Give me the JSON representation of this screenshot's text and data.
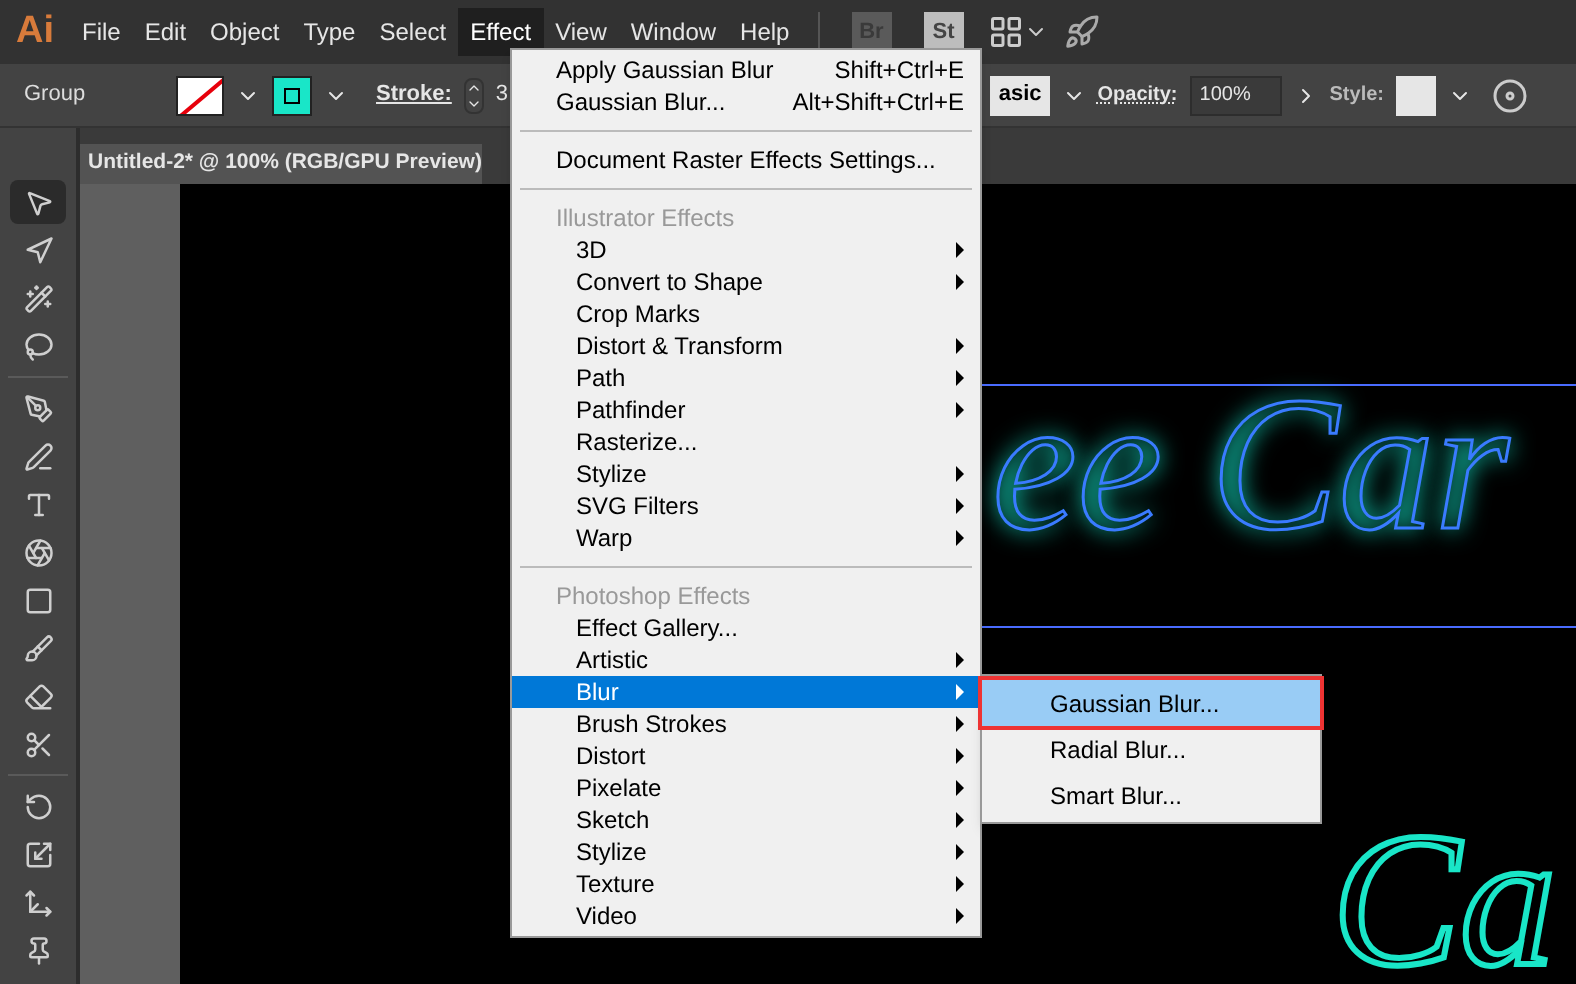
{
  "app_logo": "Ai",
  "menu_bar": [
    {
      "label": "File",
      "selected": false
    },
    {
      "label": "Edit",
      "selected": false
    },
    {
      "label": "Object",
      "selected": false
    },
    {
      "label": "Type",
      "selected": false
    },
    {
      "label": "Select",
      "selected": false
    },
    {
      "label": "Effect",
      "selected": true
    },
    {
      "label": "View",
      "selected": false
    },
    {
      "label": "Window",
      "selected": false
    },
    {
      "label": "Help",
      "selected": false
    }
  ],
  "menu_bar_badges": [
    "Br",
    "St"
  ],
  "control_bar": {
    "selection": "Group",
    "stroke_label": "Stroke:",
    "stroke_value": "3",
    "blend_value": "asic",
    "opacity_label": "Opacity:",
    "opacity_value": "100%",
    "style_label": "Style:"
  },
  "document_tab": "Untitled-2* @ 100% (RGB/GPU Preview)",
  "tools": [
    {
      "kind": "selection",
      "selected": true
    },
    {
      "kind": "direct",
      "selected": false
    },
    {
      "kind": "wand",
      "selected": false
    },
    {
      "kind": "lasso",
      "selected": false
    },
    {
      "kind": "pen",
      "selected": false
    },
    {
      "kind": "curvature",
      "selected": false
    },
    {
      "kind": "type",
      "selected": false
    },
    {
      "kind": "grid",
      "selected": false
    },
    {
      "kind": "rect",
      "selected": false
    },
    {
      "kind": "brush",
      "selected": false
    },
    {
      "kind": "shaper",
      "selected": false
    },
    {
      "kind": "scissors",
      "selected": false
    },
    {
      "kind": "rotate",
      "selected": false
    },
    {
      "kind": "scale",
      "selected": false
    },
    {
      "kind": "puppet",
      "selected": false
    },
    {
      "kind": "pin",
      "selected": false
    }
  ],
  "canvas_text": [
    "ee Car",
    "Ca"
  ],
  "effect_menu": [
    {
      "kind": "item",
      "label": "Apply Gaussian Blur",
      "shortcut": "Shift+Ctrl+E",
      "indent": false,
      "submenu": false,
      "selected": false
    },
    {
      "kind": "item",
      "label": "Gaussian Blur...",
      "shortcut": "Alt+Shift+Ctrl+E",
      "indent": false,
      "submenu": false,
      "selected": false
    },
    {
      "kind": "separator"
    },
    {
      "kind": "item",
      "label": "Document Raster Effects Settings...",
      "indent": false,
      "submenu": false,
      "selected": false
    },
    {
      "kind": "separator"
    },
    {
      "kind": "header",
      "label": "Illustrator Effects"
    },
    {
      "kind": "item",
      "label": "3D",
      "indent": true,
      "submenu": true,
      "selected": false
    },
    {
      "kind": "item",
      "label": "Convert to Shape",
      "indent": true,
      "submenu": true,
      "selected": false
    },
    {
      "kind": "item",
      "label": "Crop Marks",
      "indent": true,
      "submenu": false,
      "selected": false
    },
    {
      "kind": "item",
      "label": "Distort & Transform",
      "indent": true,
      "submenu": true,
      "selected": false
    },
    {
      "kind": "item",
      "label": "Path",
      "indent": true,
      "submenu": true,
      "selected": false
    },
    {
      "kind": "item",
      "label": "Pathfinder",
      "indent": true,
      "submenu": true,
      "selected": false
    },
    {
      "kind": "item",
      "label": "Rasterize...",
      "indent": true,
      "submenu": false,
      "selected": false
    },
    {
      "kind": "item",
      "label": "Stylize",
      "indent": true,
      "submenu": true,
      "selected": false
    },
    {
      "kind": "item",
      "label": "SVG Filters",
      "indent": true,
      "submenu": true,
      "selected": false
    },
    {
      "kind": "item",
      "label": "Warp",
      "indent": true,
      "submenu": true,
      "selected": false
    },
    {
      "kind": "separator"
    },
    {
      "kind": "header",
      "label": "Photoshop Effects"
    },
    {
      "kind": "item",
      "label": "Effect Gallery...",
      "indent": true,
      "submenu": false,
      "selected": false
    },
    {
      "kind": "item",
      "label": "Artistic",
      "indent": true,
      "submenu": true,
      "selected": false
    },
    {
      "kind": "item",
      "label": "Blur",
      "indent": true,
      "submenu": true,
      "selected": true
    },
    {
      "kind": "item",
      "label": "Brush Strokes",
      "indent": true,
      "submenu": true,
      "selected": false
    },
    {
      "kind": "item",
      "label": "Distort",
      "indent": true,
      "submenu": true,
      "selected": false
    },
    {
      "kind": "item",
      "label": "Pixelate",
      "indent": true,
      "submenu": true,
      "selected": false
    },
    {
      "kind": "item",
      "label": "Sketch",
      "indent": true,
      "submenu": true,
      "selected": false
    },
    {
      "kind": "item",
      "label": "Stylize",
      "indent": true,
      "submenu": true,
      "selected": false
    },
    {
      "kind": "item",
      "label": "Texture",
      "indent": true,
      "submenu": true,
      "selected": false
    },
    {
      "kind": "item",
      "label": "Video",
      "indent": true,
      "submenu": true,
      "selected": false
    }
  ],
  "blur_submenu": [
    {
      "label": "Gaussian Blur...",
      "selected": true
    },
    {
      "label": "Radial Blur...",
      "selected": false
    },
    {
      "label": "Smart Blur...",
      "selected": false
    }
  ]
}
